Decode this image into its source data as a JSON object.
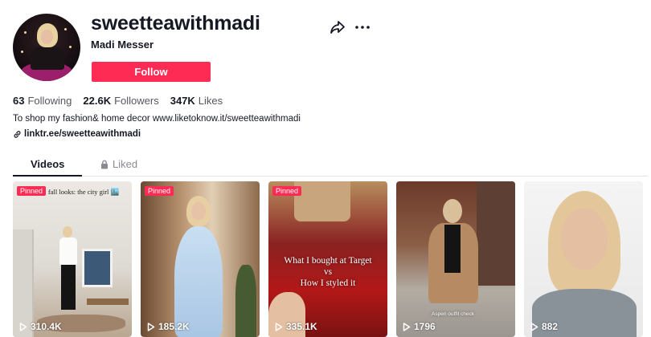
{
  "profile": {
    "username": "sweetteawithmadi",
    "display_name": "Madi Messer",
    "follow_label": "Follow",
    "bio": "To shop my fashion& home decor www.liketoknow.it/sweetteawithmadi",
    "link": "linktr.ee/sweetteawithmadi"
  },
  "stats": [
    {
      "value": "63",
      "label": "Following"
    },
    {
      "value": "22.6K",
      "label": "Followers"
    },
    {
      "value": "347K",
      "label": "Likes"
    }
  ],
  "icons": {
    "share": "share-icon",
    "more": "more-icon",
    "link": "link-icon",
    "lock": "lock-icon",
    "play": "play-icon"
  },
  "colors": {
    "accent": "#fe2c55",
    "text": "#161823",
    "muted": "#8a8b91"
  },
  "tabs": {
    "videos": "Videos",
    "liked": "Liked"
  },
  "videos": [
    {
      "pinned": "Pinned",
      "caption": "fall looks: the city girl 🏙️",
      "plays": "310.4K"
    },
    {
      "pinned": "Pinned",
      "plays": "185.2K"
    },
    {
      "pinned": "Pinned",
      "caption_line1": "What I bought at Target",
      "caption_line2": "vs",
      "caption_line3": "How I styled it",
      "plays": "335.1K"
    },
    {
      "caption": "Aspen outfit check",
      "plays": "1796"
    },
    {
      "plays": "882"
    }
  ]
}
